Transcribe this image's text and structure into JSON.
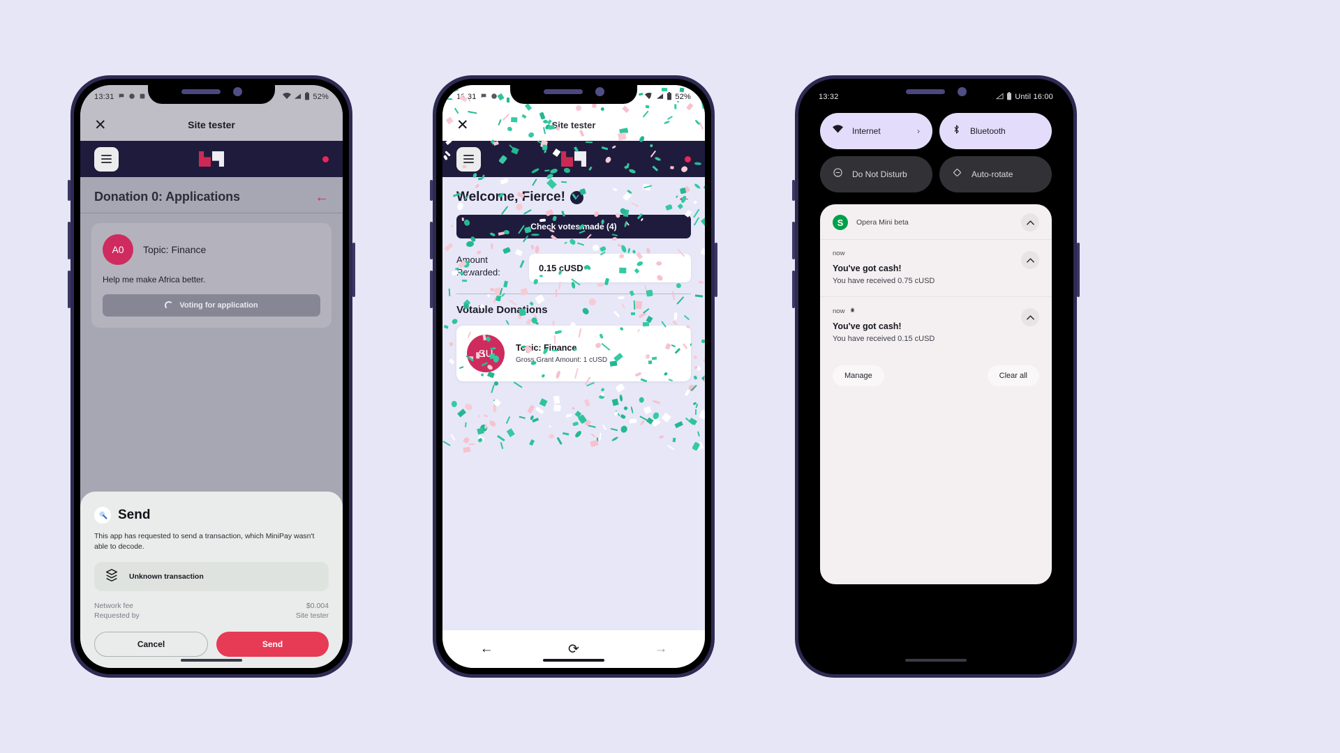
{
  "background_color": "#e6e6f7",
  "phone1": {
    "status_bar": {
      "time": "13:31",
      "battery": "52%",
      "icons": [
        "wifi-icon",
        "signal-icon",
        "battery-icon"
      ]
    },
    "app_bar": {
      "close_icon": "close-icon",
      "title": "Site tester"
    },
    "nav_bar": {
      "menu_icon": "hamburger-icon",
      "logo": "brand-logo",
      "badge": "notification-dot"
    },
    "page_title": "Donation 0: Applications",
    "back_arrow": "←",
    "application_card": {
      "avatar_initials": "A0",
      "topic": "Topic: Finance",
      "description": "Help me make Africa better.",
      "vote_button": "Voting for application",
      "spinner_icon": "loading-spinner-icon"
    },
    "send_sheet": {
      "icon": "send-wrench-icon",
      "title": "Send",
      "description": "This app has requested to send a transaction, which MiniPay wasn't able to decode.",
      "tx_icon": "layers-icon",
      "tx_label": "Unknown transaction",
      "rows": [
        {
          "label": "Network fee",
          "value": "$0.004"
        },
        {
          "label": "Requested by",
          "value": "Site tester"
        }
      ],
      "cancel_label": "Cancel",
      "send_label": "Send",
      "send_color": "#e63a55"
    }
  },
  "phone2": {
    "status_bar": {
      "time": "13:31",
      "battery": "52%"
    },
    "app_bar": {
      "close_icon": "close-icon",
      "title": "Site tester"
    },
    "nav_bar": {
      "menu_icon": "hamburger-icon",
      "logo": "brand-logo",
      "badge": "notification-dot"
    },
    "welcome_title": "Welcome, Fierce!",
    "welcome_badge": "verified-check-icon",
    "back_arrow": "←",
    "cta_label": "Check votes made (4)",
    "amount_label": "Amount Rewarded:",
    "amount_value": "0.15 cUSD",
    "section_title": "Votable Donations",
    "donation_card": {
      "avatar_initials": "SU",
      "topic": "Topic: Finance",
      "grant": "Gross Grant Amount: 1 cUSD"
    },
    "browser_bar": {
      "back": "←",
      "reload": "⟳",
      "forward": "→"
    }
  },
  "phone3": {
    "status_bar": {
      "time": "13:32",
      "battery_text": "Until 16:00"
    },
    "quick_settings": [
      {
        "label": "Internet",
        "icon": "wifi-icon",
        "state": "on",
        "chevron": "›"
      },
      {
        "label": "Bluetooth",
        "icon": "bluetooth-icon",
        "state": "on",
        "chevron": ""
      },
      {
        "label": "Do Not Disturb",
        "icon": "dnd-icon",
        "state": "off",
        "chevron": ""
      },
      {
        "label": "Auto-rotate",
        "icon": "auto-rotate-icon",
        "state": "off",
        "chevron": ""
      }
    ],
    "notification_group": {
      "app_icon_letter": "S",
      "app_name": "Opera Mini beta",
      "collapse_icon": "chevron-up-icon",
      "items": [
        {
          "time": "now",
          "title": "You've got cash!",
          "body": "You have received 0.75 cUSD",
          "has_bug_icon": false
        },
        {
          "time": "now",
          "title": "You've got cash!",
          "body": "You have received 0.15 cUSD",
          "has_bug_icon": true
        }
      ]
    },
    "manage_label": "Manage",
    "clear_all_label": "Clear all"
  }
}
